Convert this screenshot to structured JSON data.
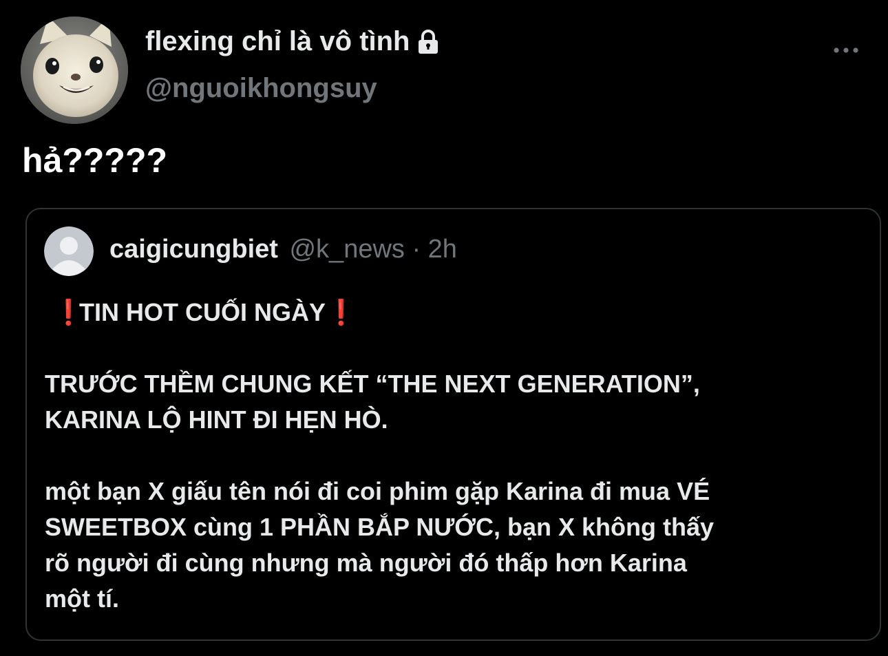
{
  "author": {
    "display_name": "flexing chỉ là vô tình",
    "handle": "@nguoikhongsuy",
    "avatar_icon": "cat-avatar",
    "protected_icon": "lock-icon"
  },
  "menu": {
    "more_icon": "more-horizontal-icon"
  },
  "tweet": {
    "text": "hả?????"
  },
  "quoted_tweet": {
    "author_name": "caigicungbiet",
    "meta": "@k_news · 2h",
    "avatar_icon": "default-user-avatar",
    "emoji_icon": "red-exclamation-icon",
    "emoji_char": "❗",
    "headline": "TIN HOT CUỐI NGÀY",
    "paragraph_1_line_1": "TRƯỚC THỀM CHUNG KẾT “THE NEXT GENERATION”,",
    "paragraph_1_line_2": "KARINA LỘ HINT ĐI HẸN HÒ.",
    "paragraph_2_line_1": "một bạn X giấu tên nói đi coi phim gặp Karina đi mua VÉ",
    "paragraph_2_line_2": "SWEETBOX cùng 1 PHẦN BẮP NƯỚC, bạn X không thấy",
    "paragraph_2_line_3": "rõ người đi cùng nhưng mà người đó thấp hơn Karina",
    "paragraph_2_line_4": "một tí."
  },
  "colors": {
    "background": "#000000",
    "text_primary": "#e7e9ea",
    "text_secondary": "#71767b",
    "border": "#2f3336",
    "accent_red": "#e0242a"
  }
}
